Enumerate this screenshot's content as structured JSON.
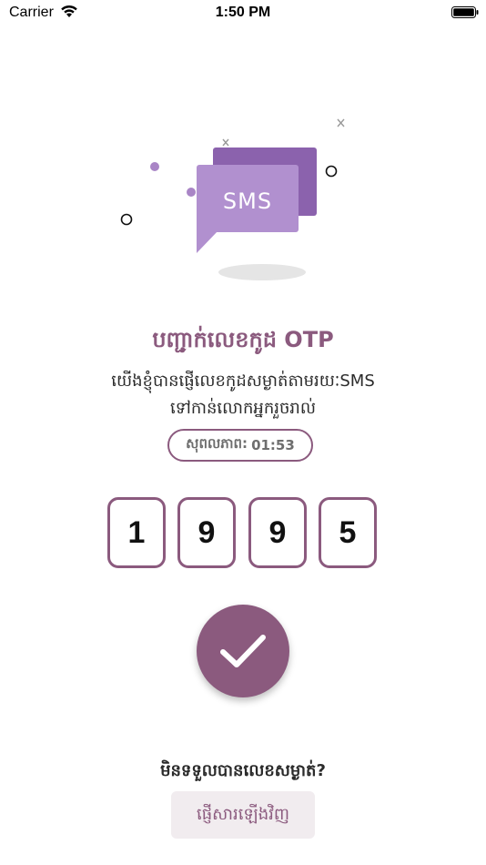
{
  "status_bar": {
    "carrier": "Carrier",
    "time": "1:50 PM"
  },
  "illustration": {
    "label": "SMS",
    "colors": {
      "front_bubble": "#b190cf",
      "back_bubble": "#8b62ad"
    }
  },
  "title": "បញ្ជាក់លេខកូដ OTP",
  "subtitle_line1": "យើងខ្ញុំបានផ្ញើលេខកូដសម្ងាត់តាមរយៈSMS",
  "subtitle_line2": "ទៅកាន់លោកអ្នករួចរាល់",
  "timer": {
    "label": "សុពលភាព:",
    "value": "01:53"
  },
  "otp": {
    "digits": [
      "1",
      "9",
      "9",
      "5"
    ]
  },
  "confirm_icon": "checkmark-icon",
  "resend": {
    "question": "មិនទទួលបានលេខសម្ងាត់?",
    "button_label": "ផ្ញើសារឡើងវិញ"
  },
  "colors": {
    "accent": "#8b5a7e",
    "resend_bg": "#f1ecef"
  }
}
